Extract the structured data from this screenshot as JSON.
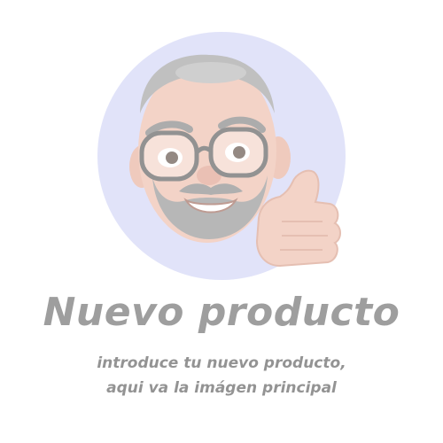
{
  "title": "Nuevo producto",
  "subtitle_line1": "introduce tu nuevo producto,",
  "subtitle_line2": "aqui va la imágen principal",
  "colors": {
    "background": "#ffffff",
    "circle": "#c9cdf5",
    "skin": "#e8a98f",
    "beard": "#8a8a8a",
    "title_text": "#505050"
  }
}
